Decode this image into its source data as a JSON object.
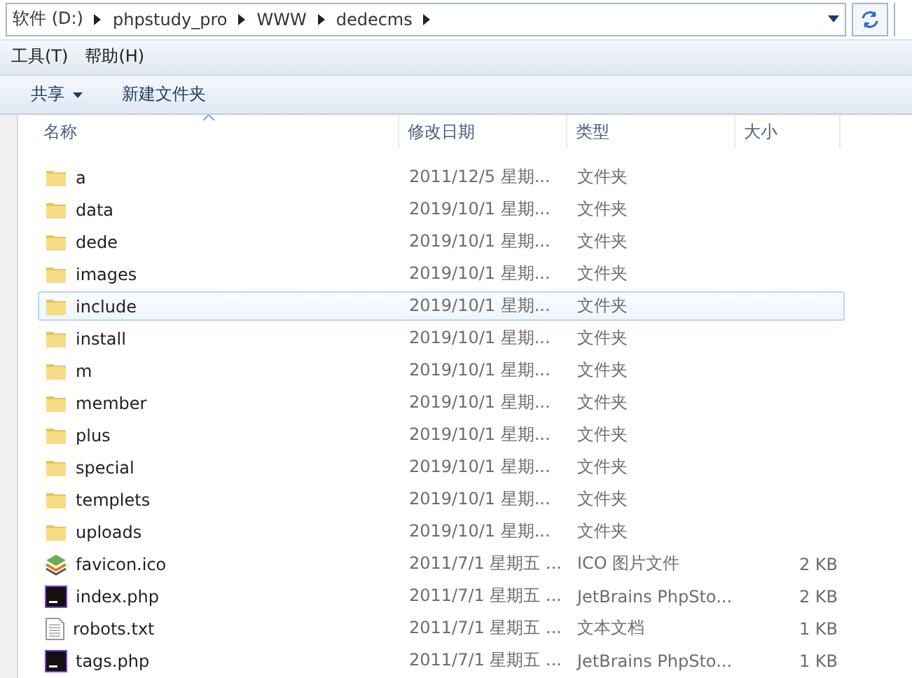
{
  "address_bar": {
    "segments": [
      "软件 (D:)",
      "phpstudy_pro",
      "WWW",
      "dedecms"
    ]
  },
  "menu": [
    "工具(T)",
    "帮助(H)"
  ],
  "toolbar": {
    "share": "共享",
    "new_folder": "新建文件夹"
  },
  "columns": [
    "名称",
    "修改日期",
    "类型",
    "大小"
  ],
  "files": [
    {
      "kind": "folder",
      "name": "a",
      "date": "2011/12/5 星期...",
      "type": "文件夹",
      "selected": false
    },
    {
      "kind": "folder",
      "name": "data",
      "date": "2019/10/1 星期...",
      "type": "文件夹",
      "selected": false
    },
    {
      "kind": "folder",
      "name": "dede",
      "date": "2019/10/1 星期...",
      "type": "文件夹",
      "selected": false
    },
    {
      "kind": "folder",
      "name": "images",
      "date": "2019/10/1 星期...",
      "type": "文件夹",
      "selected": false
    },
    {
      "kind": "folder",
      "name": "include",
      "date": "2019/10/1 星期...",
      "type": "文件夹",
      "selected": true
    },
    {
      "kind": "folder",
      "name": "install",
      "date": "2019/10/1 星期...",
      "type": "文件夹",
      "selected": false
    },
    {
      "kind": "folder",
      "name": "m",
      "date": "2019/10/1 星期...",
      "type": "文件夹",
      "selected": false
    },
    {
      "kind": "folder",
      "name": "member",
      "date": "2019/10/1 星期...",
      "type": "文件夹",
      "selected": false
    },
    {
      "kind": "folder",
      "name": "plus",
      "date": "2019/10/1 星期...",
      "type": "文件夹",
      "selected": false
    },
    {
      "kind": "folder",
      "name": "special",
      "date": "2019/10/1 星期...",
      "type": "文件夹",
      "selected": false
    },
    {
      "kind": "folder",
      "name": "templets",
      "date": "2019/10/1 星期...",
      "type": "文件夹",
      "selected": false
    },
    {
      "kind": "folder",
      "name": "uploads",
      "date": "2019/10/1 星期...",
      "type": "文件夹",
      "selected": false
    },
    {
      "kind": "ico",
      "name": "favicon.ico",
      "date": "2011/7/1 星期五 ...",
      "type": "ICO 图片文件",
      "size": "2 KB",
      "selected": false
    },
    {
      "kind": "php",
      "name": "index.php",
      "date": "2011/7/1 星期五 ...",
      "type": "JetBrains PhpSto...",
      "size": "2 KB",
      "selected": false
    },
    {
      "kind": "txt",
      "name": "robots.txt",
      "date": "2011/7/1 星期五 ...",
      "type": "文本文档",
      "size": "1 KB",
      "selected": false
    },
    {
      "kind": "php",
      "name": "tags.php",
      "date": "2011/7/1 星期五 ...",
      "type": "JetBrains PhpSto...",
      "size": "1 KB",
      "selected": false
    }
  ]
}
